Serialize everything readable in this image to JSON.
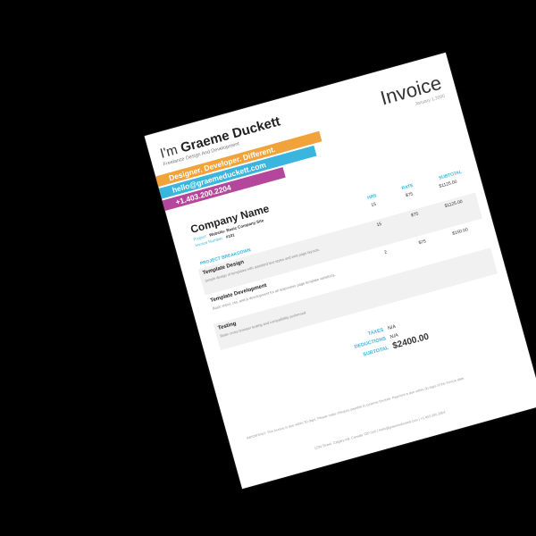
{
  "header": {
    "greeting": "I'm",
    "name": "Graeme Duckett",
    "subtitle": "Freelance Design And Development",
    "tagline": "Designer. Developer. Different.",
    "email": "hello@graemeduckett.com",
    "phone": "+1.403.200.2204",
    "invoice_title": "Invoice",
    "invoice_date": "January 1,2000"
  },
  "client": {
    "company": "Company Name",
    "project_label": "Project:",
    "project_value": "Website: Basic Company Site",
    "invoice_label": "Invoice Number:",
    "invoice_value": "#101"
  },
  "table": {
    "breakdown_label": "PROJECT BREAKDOWN",
    "headers": {
      "hrs": "HRS",
      "rate": "RATE",
      "subtotal": "SUBTOTAL"
    },
    "top_row": {
      "hrs": "15",
      "rate": "$75",
      "subtotal": "$1125.00"
    },
    "items": [
      {
        "name": "Template Design",
        "desc": "Simple design of templates with standard text styles and web page layouts.",
        "hrs": "15",
        "rate": "$75",
        "subtotal": "$1125.00"
      },
      {
        "name": "Template Development",
        "desc": "Basic xhtml, css, and js development for all responsive page template variations.",
        "hrs": "2",
        "rate": "$75",
        "subtotal": "$150.00"
      },
      {
        "name": "Testing",
        "desc": "Basic cross browser testing and compatibility performed.",
        "hrs": "",
        "rate": "",
        "subtotal": ""
      }
    ]
  },
  "totals": {
    "taxes_label": "TAXES",
    "taxes_value": "N/A",
    "deductions_label": "DEDUCTIONS",
    "deductions_value": "N/A",
    "subtotal_label": "SUBTOTAL",
    "subtotal_value": "$2400.00"
  },
  "footer": {
    "note": "IMPORTANT: This invoice is due within 30 days. Please make cheques payable to Graeme Duckett. Payment is due within 30 days of the invoice date.",
    "contact": "1234 Street, Calgary AB, Canada T2P 0X0 | hello@graemeduckett.com | +1.403.200.2204"
  },
  "colors": {
    "orange": "#f2a23a",
    "blue": "#3ab5de",
    "purple": "#b4479b"
  }
}
